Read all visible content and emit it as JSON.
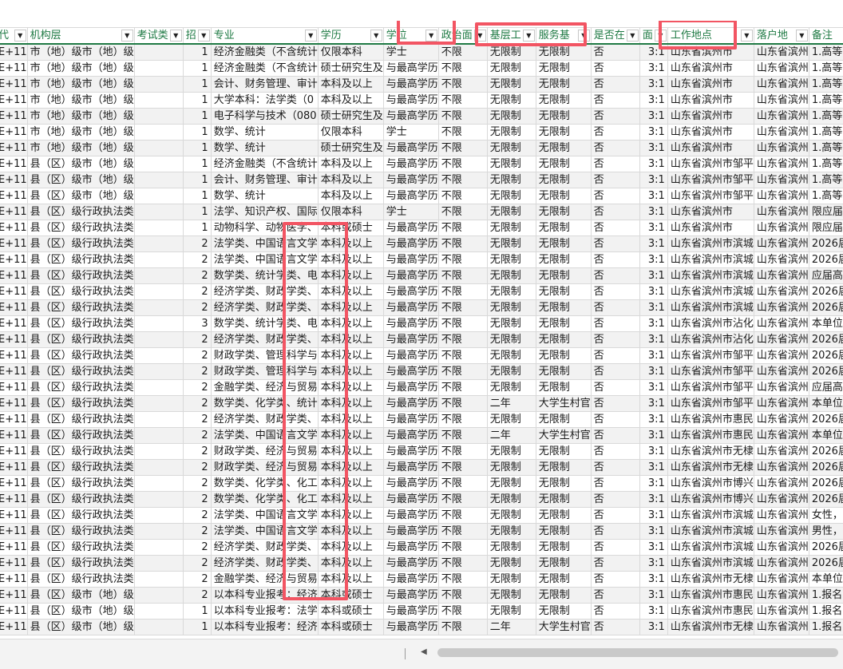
{
  "columns": [
    {
      "label": "代",
      "w": 38
    },
    {
      "label": "机构层",
      "w": 70
    },
    {
      "label": "考试类",
      "w": 70
    },
    {
      "label": "招",
      "w": 42
    },
    {
      "label": "专业",
      "w": 140
    },
    {
      "label": "学历",
      "w": 78
    },
    {
      "label": "学位",
      "w": 68
    },
    {
      "label": "政治面",
      "w": 70
    },
    {
      "label": "基层工",
      "w": 68
    },
    {
      "label": "服务基",
      "w": 70
    },
    {
      "label": "是否在",
      "w": 68
    },
    {
      "label": "面",
      "w": 48
    },
    {
      "label": "工作地点",
      "w": 106
    },
    {
      "label": "落户地",
      "w": 68
    },
    {
      "label": "备注",
      "w": 56
    }
  ],
  "rows": [
    [
      "E+11",
      "市（地）级市（地）级",
      "",
      "1",
      "经济金融类（不含统计",
      "仅限本科",
      "学士",
      "不限",
      "无限制",
      "无限制",
      "否",
      "3:1",
      "山东省滨州市",
      "山东省滨州",
      "1.高等学"
    ],
    [
      "E+11",
      "市（地）级市（地）级",
      "",
      "1",
      "经济金融类（不含统计",
      "硕士研究生及",
      "与最高学历",
      "不限",
      "无限制",
      "无限制",
      "否",
      "3:1",
      "山东省滨州市",
      "山东省滨州",
      "1.高等学"
    ],
    [
      "E+11",
      "市（地）级市（地）级",
      "",
      "1",
      "会计、财务管理、审计",
      "本科及以上",
      "与最高学历",
      "不限",
      "无限制",
      "无限制",
      "否",
      "3:1",
      "山东省滨州市",
      "山东省滨州",
      "1.高等学"
    ],
    [
      "E+11",
      "市（地）级市（地）级",
      "",
      "1",
      "大学本科：法学类（0",
      "本科及以上",
      "与最高学历",
      "不限",
      "无限制",
      "无限制",
      "否",
      "3:1",
      "山东省滨州市",
      "山东省滨州",
      "1.高等学"
    ],
    [
      "E+11",
      "市（地）级市（地）级",
      "",
      "1",
      "电子科学与技术（080",
      "硕士研究生及",
      "与最高学历",
      "不限",
      "无限制",
      "无限制",
      "否",
      "3:1",
      "山东省滨州市",
      "山东省滨州",
      "1.高等学"
    ],
    [
      "E+11",
      "市（地）级市（地）级",
      "",
      "1",
      "数学、统计",
      "仅限本科",
      "学士",
      "不限",
      "无限制",
      "无限制",
      "否",
      "3:1",
      "山东省滨州市",
      "山东省滨州",
      "1.高等学"
    ],
    [
      "E+11",
      "市（地）级市（地）级",
      "",
      "1",
      "数学、统计",
      "硕士研究生及",
      "与最高学历",
      "不限",
      "无限制",
      "无限制",
      "否",
      "3:1",
      "山东省滨州市",
      "山东省滨州",
      "1.高等学"
    ],
    [
      "E+11",
      "县（区）级市（地）级",
      "",
      "1",
      "经济金融类（不含统计",
      "本科及以上",
      "与最高学历",
      "不限",
      "无限制",
      "无限制",
      "否",
      "3:1",
      "山东省滨州市邹平",
      "山东省滨州",
      "1.高等学"
    ],
    [
      "E+11",
      "县（区）级市（地）级",
      "",
      "1",
      "会计、财务管理、审计",
      "本科及以上",
      "与最高学历",
      "不限",
      "无限制",
      "无限制",
      "否",
      "3:1",
      "山东省滨州市邹平",
      "山东省滨州",
      "1.高等学"
    ],
    [
      "E+11",
      "县（区）级市（地）级",
      "",
      "1",
      "数学、统计",
      "本科及以上",
      "与最高学历",
      "不限",
      "无限制",
      "无限制",
      "否",
      "3:1",
      "山东省滨州市邹平",
      "山东省滨州",
      "1.高等学"
    ],
    [
      "E+11",
      "县（区）级行政执法类",
      "",
      "1",
      "法学、知识产权、国际",
      "仅限本科",
      "学士",
      "不限",
      "无限制",
      "无限制",
      "否",
      "3:1",
      "山东省滨州市",
      "山东省滨州",
      "限应届高"
    ],
    [
      "E+11",
      "县（区）级行政执法类",
      "",
      "1",
      "动物科学、动物医学、",
      "本科或硕士",
      "与最高学历",
      "不限",
      "无限制",
      "无限制",
      "否",
      "3:1",
      "山东省滨州市",
      "山东省滨州",
      "限应届高"
    ],
    [
      "E+11",
      "县（区）级行政执法类",
      "",
      "2",
      "法学类、中国语言文学",
      "本科及以上",
      "与最高学历",
      "不限",
      "无限制",
      "无限制",
      "否",
      "3:1",
      "山东省滨州市滨城",
      "山东省滨州",
      "2026届高"
    ],
    [
      "E+11",
      "县（区）级行政执法类",
      "",
      "2",
      "法学类、中国语言文学",
      "本科及以上",
      "与最高学历",
      "不限",
      "无限制",
      "无限制",
      "否",
      "3:1",
      "山东省滨州市滨城",
      "山东省滨州",
      "2026届高"
    ],
    [
      "E+11",
      "县（区）级行政执法类",
      "",
      "2",
      "数学类、统计学类、电",
      "本科及以上",
      "与最高学历",
      "不限",
      "无限制",
      "无限制",
      "否",
      "3:1",
      "山东省滨州市滨城",
      "山东省滨州",
      "应届高校"
    ],
    [
      "E+11",
      "县（区）级行政执法类",
      "",
      "2",
      "经济学类、财政学类、",
      "本科及以上",
      "与最高学历",
      "不限",
      "无限制",
      "无限制",
      "否",
      "3:1",
      "山东省滨州市滨城",
      "山东省滨州",
      "2026届高"
    ],
    [
      "E+11",
      "县（区）级行政执法类",
      "",
      "2",
      "经济学类、财政学类、",
      "本科及以上",
      "与最高学历",
      "不限",
      "无限制",
      "无限制",
      "否",
      "3:1",
      "山东省滨州市滨城",
      "山东省滨州",
      "2026届高"
    ],
    [
      "E+11",
      "县（区）级行政执法类",
      "",
      "3",
      "数学类、统计学类、电",
      "本科及以上",
      "与最高学历",
      "不限",
      "无限制",
      "无限制",
      "否",
      "3:1",
      "山东省滨州市沾化",
      "山东省滨州",
      "本单位可"
    ],
    [
      "E+11",
      "县（区）级行政执法类",
      "",
      "2",
      "经济学类、财政学类、",
      "本科及以上",
      "与最高学历",
      "不限",
      "无限制",
      "无限制",
      "否",
      "3:1",
      "山东省滨州市沾化",
      "山东省滨州",
      "2026届高"
    ],
    [
      "E+11",
      "县（区）级行政执法类",
      "",
      "2",
      "财政学类、管理科学与",
      "本科及以上",
      "与最高学历",
      "不限",
      "无限制",
      "无限制",
      "否",
      "3:1",
      "山东省滨州市邹平",
      "山东省滨州",
      "2026届高"
    ],
    [
      "E+11",
      "县（区）级行政执法类",
      "",
      "2",
      "财政学类、管理科学与",
      "本科及以上",
      "与最高学历",
      "不限",
      "无限制",
      "无限制",
      "否",
      "3:1",
      "山东省滨州市邹平",
      "山东省滨州",
      "2026届高"
    ],
    [
      "E+11",
      "县（区）级行政执法类",
      "",
      "2",
      "金融学类、经济与贸易",
      "本科及以上",
      "与最高学历",
      "不限",
      "无限制",
      "无限制",
      "否",
      "3:1",
      "山东省滨州市邹平",
      "山东省滨州",
      "应届高校"
    ],
    [
      "E+11",
      "县（区）级行政执法类",
      "",
      "2",
      "数学类、化学类、统计",
      "本科及以上",
      "与最高学历",
      "不限",
      "二年",
      "大学生村官",
      "否",
      "3:1",
      "山东省滨州市邹平",
      "山东省滨州",
      "本单位可"
    ],
    [
      "E+11",
      "县（区）级行政执法类",
      "",
      "2",
      "经济学类、财政学类、",
      "本科及以上",
      "与最高学历",
      "不限",
      "无限制",
      "无限制",
      "否",
      "3:1",
      "山东省滨州市惠民",
      "山东省滨州",
      "2026届高"
    ],
    [
      "E+11",
      "县（区）级行政执法类",
      "",
      "2",
      "法学类、中国语言文学",
      "本科及以上",
      "与最高学历",
      "不限",
      "二年",
      "大学生村官",
      "否",
      "3:1",
      "山东省滨州市惠民",
      "山东省滨州",
      "本单位可"
    ],
    [
      "E+11",
      "县（区）级行政执法类",
      "",
      "2",
      "财政学类、经济与贸易",
      "本科及以上",
      "与最高学历",
      "不限",
      "无限制",
      "无限制",
      "否",
      "3:1",
      "山东省滨州市无棣",
      "山东省滨州",
      "2026届高"
    ],
    [
      "E+11",
      "县（区）级行政执法类",
      "",
      "2",
      "财政学类、经济与贸易",
      "本科及以上",
      "与最高学历",
      "不限",
      "无限制",
      "无限制",
      "否",
      "3:1",
      "山东省滨州市无棣",
      "山东省滨州",
      "2026届高"
    ],
    [
      "E+11",
      "县（区）级行政执法类",
      "",
      "2",
      "数学类、化学类、化工",
      "本科及以上",
      "与最高学历",
      "不限",
      "无限制",
      "无限制",
      "否",
      "3:1",
      "山东省滨州市博兴",
      "山东省滨州",
      "2026届高"
    ],
    [
      "E+11",
      "县（区）级行政执法类",
      "",
      "2",
      "数学类、化学类、化工",
      "本科及以上",
      "与最高学历",
      "不限",
      "无限制",
      "无限制",
      "否",
      "3:1",
      "山东省滨州市博兴",
      "山东省滨州",
      "2026届高"
    ],
    [
      "E+11",
      "县（区）级行政执法类",
      "",
      "2",
      "法学类、中国语言文学",
      "本科及以上",
      "与最高学历",
      "不限",
      "无限制",
      "无限制",
      "否",
      "3:1",
      "山东省滨州市滨城",
      "山东省滨州",
      "女性，本"
    ],
    [
      "E+11",
      "县（区）级行政执法类",
      "",
      "2",
      "法学类、中国语言文学",
      "本科及以上",
      "与最高学历",
      "不限",
      "无限制",
      "无限制",
      "否",
      "3:1",
      "山东省滨州市滨城",
      "山东省滨州",
      "男性，本"
    ],
    [
      "E+11",
      "县（区）级行政执法类",
      "",
      "2",
      "经济学类、财政学类、",
      "本科及以上",
      "与最高学历",
      "不限",
      "无限制",
      "无限制",
      "否",
      "3:1",
      "山东省滨州市滨城",
      "山东省滨州",
      "2026届高"
    ],
    [
      "E+11",
      "县（区）级行政执法类",
      "",
      "2",
      "经济学类、财政学类、",
      "本科及以上",
      "与最高学历",
      "不限",
      "无限制",
      "无限制",
      "否",
      "3:1",
      "山东省滨州市滨城",
      "山东省滨州",
      "2026届高"
    ],
    [
      "E+11",
      "县（区）级行政执法类",
      "",
      "2",
      "金融学类、经济与贸易",
      "本科及以上",
      "与最高学历",
      "不限",
      "无限制",
      "无限制",
      "否",
      "3:1",
      "山东省滨州市无棣",
      "山东省滨州",
      "本单位可"
    ],
    [
      "E+11",
      "县（区）级市（地）级",
      "",
      "2",
      "以本科专业报考：经济",
      "本科或硕士",
      "与最高学历",
      "不限",
      "无限制",
      "无限制",
      "否",
      "3:1",
      "山东省滨州市惠民",
      "山东省滨州",
      "1.报名时"
    ],
    [
      "E+11",
      "县（区）级市（地）级",
      "",
      "1",
      "以本科专业报考：法学",
      "本科或硕士",
      "与最高学历",
      "不限",
      "无限制",
      "无限制",
      "否",
      "3:1",
      "山东省滨州市惠民",
      "山东省滨州",
      "1.报名时"
    ],
    [
      "E+11",
      "县（区）级市（地）级",
      "",
      "1",
      "以本科专业报考：经济",
      "本科或硕士",
      "与最高学历",
      "不限",
      "二年",
      "大学生村官",
      "否",
      "3:1",
      "山东省滨州市无棣",
      "山东省滨州",
      "1.报名时"
    ]
  ],
  "filter_icon": "dropdown-triangle",
  "highlight_color": "#f25563"
}
